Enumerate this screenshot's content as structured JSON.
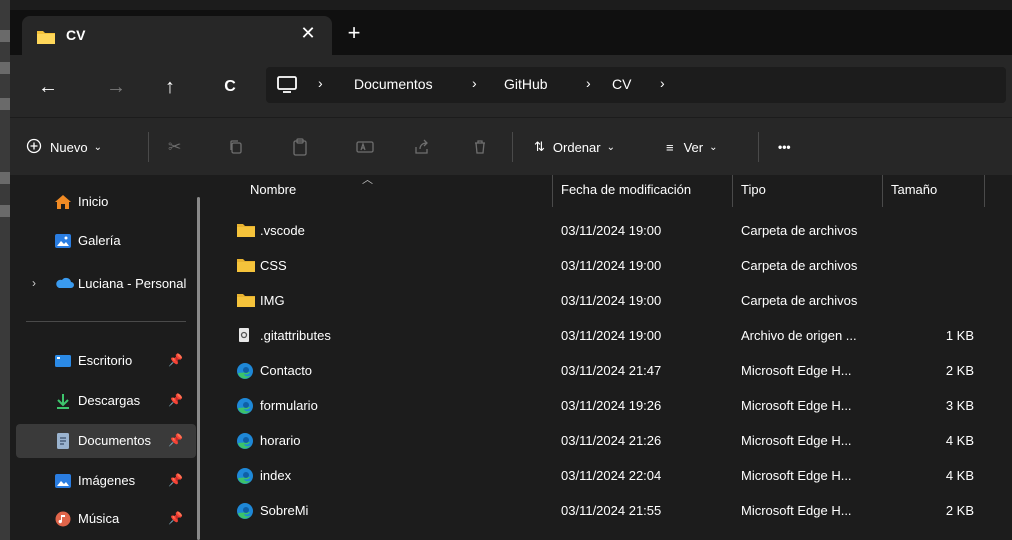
{
  "tab": {
    "title": "CV",
    "close": "✕",
    "new": "+"
  },
  "nav": {
    "back": "←",
    "forward": "→",
    "up": "↑",
    "refresh": "C"
  },
  "breadcrumbs": [
    "Documentos",
    "GitHub",
    "CV"
  ],
  "toolbar": {
    "new_label": "Nuevo",
    "sort_label": "Ordenar",
    "view_label": "Ver",
    "more_label": "•••"
  },
  "sidebar": {
    "items": [
      {
        "label": "Inicio"
      },
      {
        "label": "Galería"
      },
      {
        "label": "Luciana - Personal"
      },
      {
        "label": "Escritorio"
      },
      {
        "label": "Descargas"
      },
      {
        "label": "Documentos"
      },
      {
        "label": "Imágenes"
      },
      {
        "label": "Música"
      }
    ]
  },
  "columns": {
    "name": "Nombre",
    "date": "Fecha de modificación",
    "type": "Tipo",
    "size": "Tamaño"
  },
  "files": [
    {
      "name": ".vscode",
      "date": "03/11/2024 19:00",
      "type": "Carpeta de archivos",
      "size": "",
      "icon": "folder-icon"
    },
    {
      "name": "CSS",
      "date": "03/11/2024 19:00",
      "type": "Carpeta de archivos",
      "size": "",
      "icon": "folder-icon"
    },
    {
      "name": "IMG",
      "date": "03/11/2024 19:00",
      "type": "Carpeta de archivos",
      "size": "",
      "icon": "folder-icon"
    },
    {
      "name": ".gitattributes",
      "date": "03/11/2024 19:00",
      "type": "Archivo de origen ...",
      "size": "1 KB",
      "icon": "file-icon"
    },
    {
      "name": "Contacto",
      "date": "03/11/2024 21:47",
      "type": "Microsoft Edge H...",
      "size": "2 KB",
      "icon": "edge-icon"
    },
    {
      "name": "formulario",
      "date": "03/11/2024 19:26",
      "type": "Microsoft Edge H...",
      "size": "3 KB",
      "icon": "edge-icon"
    },
    {
      "name": "horario",
      "date": "03/11/2024 21:26",
      "type": "Microsoft Edge H...",
      "size": "4 KB",
      "icon": "edge-icon"
    },
    {
      "name": "index",
      "date": "03/11/2024 22:04",
      "type": "Microsoft Edge H...",
      "size": "4 KB",
      "icon": "edge-icon"
    },
    {
      "name": "SobreMi",
      "date": "03/11/2024 21:55",
      "type": "Microsoft Edge H...",
      "size": "2 KB",
      "icon": "edge-icon"
    }
  ],
  "colors": {
    "folder": "#f5c33b",
    "edge_blue": "#1e88d8",
    "edge_green": "#3cc26a",
    "selected": "#3a3a3a"
  }
}
